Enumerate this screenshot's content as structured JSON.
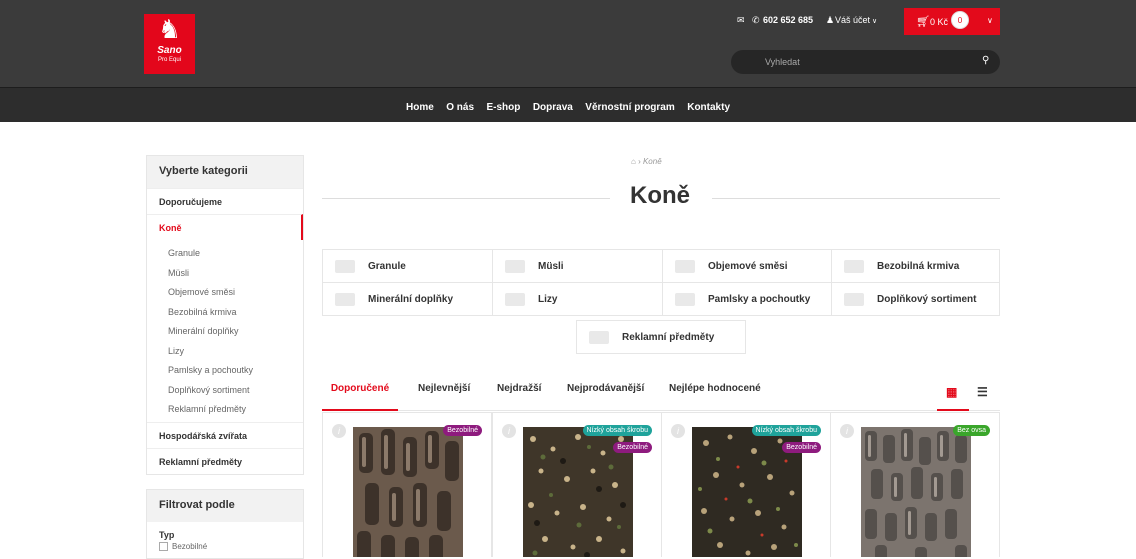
{
  "header": {
    "logo_brand": "Sano",
    "logo_sub": "Pro Equi",
    "mail_icon": "envelope-icon",
    "phone": "602 652 685",
    "account": "Váš účet",
    "cart_amount": "0 Kč",
    "cart_count": "0",
    "search_placeholder": "Vyhledat",
    "colors": {
      "topbar": "#3b3b3b",
      "accent": "#e30a1b",
      "nav": "#2d2d2d"
    }
  },
  "nav": [
    "Home",
    "O nás",
    "E-shop",
    "Doprava",
    "Věrnostní program",
    "Kontakty"
  ],
  "sidebar": {
    "title": "Vyberte kategorii",
    "top_items": [
      "Doporučujeme",
      "Koně"
    ],
    "sub_items": [
      "Granule",
      "Müsli",
      "Objemové směsi",
      "Bezobilná krmiva",
      "Minerální doplňky",
      "Lizy",
      "Pamlsky a pochoutky",
      "Doplňkový sortiment",
      "Reklamní předměty"
    ],
    "bottom_items": [
      "Hospodářská zvířata",
      "Reklamní předměty"
    ]
  },
  "filter": {
    "title": "Filtrovat podle",
    "group": "Typ",
    "option": "Bezobilné"
  },
  "breadcrumb": {
    "home_icon": "home-icon",
    "current": "Koně"
  },
  "page_title": "Koně",
  "categories": [
    "Granule",
    "Müsli",
    "Objemové směsi",
    "Bezobilná krmiva",
    "Minerální doplňky",
    "Lizy",
    "Pamlsky a pochoutky",
    "Doplňkový sortiment",
    "Reklamní předměty"
  ],
  "sort_tabs": [
    "Doporučené",
    "Nejlevnější",
    "Nejdražší",
    "Nejprodávanější",
    "Nejlépe hodnocené"
  ],
  "products": [
    {
      "tags": [
        {
          "text": "Bezobilné",
          "color": "#8e1b7e"
        }
      ],
      "image": "pellets-dark"
    },
    {
      "tags": [
        {
          "text": "Nízký obsah škrobu",
          "color": "#1fa39b"
        },
        {
          "text": "Bezobilné",
          "color": "#8e1b7e"
        }
      ],
      "image": "muesli-mix"
    },
    {
      "tags": [
        {
          "text": "Nízký obsah škrobu",
          "color": "#1fa39b"
        },
        {
          "text": "Bezobilné",
          "color": "#8e1b7e"
        }
      ],
      "image": "muesli-mix-dark"
    },
    {
      "tags": [
        {
          "text": "Bez ovsa",
          "color": "#3aa62b"
        }
      ],
      "image": "pellets-grey"
    }
  ]
}
